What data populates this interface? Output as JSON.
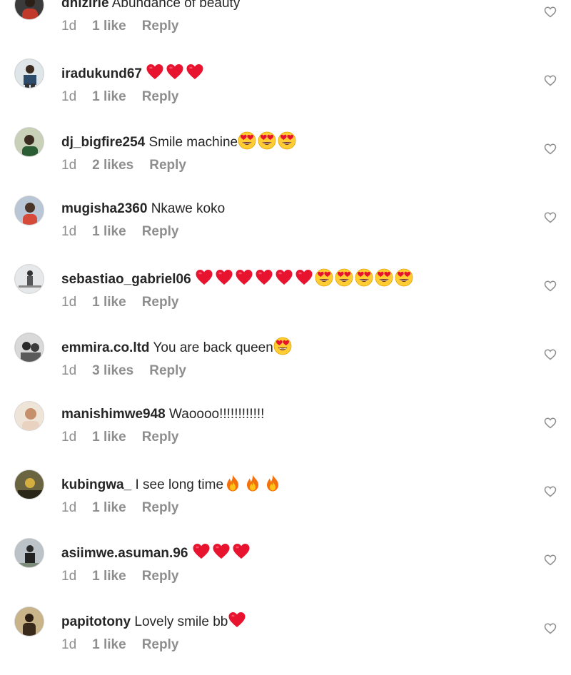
{
  "comments": [
    {
      "username": "dhizirie",
      "text": "Abundance of beauty",
      "emojis": [],
      "time": "1d",
      "likes": "1 like",
      "reply": "Reply",
      "avatar_color": "#3b3b3b"
    },
    {
      "username": "iradukund67",
      "text": "",
      "emojis": [
        "red-heart",
        "red-heart",
        "red-heart"
      ],
      "time": "1d",
      "likes": "1 like",
      "reply": "Reply",
      "avatar_color": "#6a7f8f"
    },
    {
      "username": "dj_bigfire254",
      "text": "Smile machine",
      "emojis": [
        "heart-eyes",
        "heart-eyes",
        "heart-eyes"
      ],
      "time": "1d",
      "likes": "2 likes",
      "reply": "Reply",
      "avatar_color": "#7b8a6a"
    },
    {
      "username": "mugisha2360",
      "text": "Nkawe koko",
      "emojis": [],
      "time": "1d",
      "likes": "1 like",
      "reply": "Reply",
      "avatar_color": "#8e8a86"
    },
    {
      "username": "sebastiao_gabriel06",
      "text": "",
      "emojis": [
        "red-heart",
        "red-heart",
        "red-heart",
        "red-heart",
        "red-heart",
        "red-heart",
        "heart-eyes",
        "heart-eyes",
        "heart-eyes",
        "heart-eyes",
        "heart-eyes"
      ],
      "time": "1d",
      "likes": "1 like",
      "reply": "Reply",
      "avatar_color": "#9aa0a6"
    },
    {
      "username": "emmira.co.ltd",
      "text": "You are back queen",
      "emojis": [
        "heart-eyes"
      ],
      "time": "1d",
      "likes": "3 likes",
      "reply": "Reply",
      "avatar_color": "#555555"
    },
    {
      "username": "manishimwe948",
      "text": "Waoooo!!!!!!!!!!!!",
      "emojis": [],
      "time": "1d",
      "likes": "1 like",
      "reply": "Reply",
      "avatar_color": "#c9b7a5"
    },
    {
      "username": "kubingwa_",
      "text": "I see long time",
      "emojis": [
        "fire",
        "fire",
        "fire"
      ],
      "time": "1d",
      "likes": "1 like",
      "reply": "Reply",
      "avatar_color": "#4a4632"
    },
    {
      "username": "asiimwe.asuman.96",
      "text": "",
      "emojis": [
        "red-heart",
        "red-heart",
        "red-heart"
      ],
      "time": "1d",
      "likes": "1 like",
      "reply": "Reply",
      "avatar_color": "#5d6068"
    },
    {
      "username": "papitotony",
      "text": "Lovely smile bb",
      "emojis": [
        "red-heart"
      ],
      "time": "1d",
      "likes": "1 like",
      "reply": "Reply",
      "avatar_color": "#6b5a3e"
    }
  ],
  "colors": {
    "text": "#262626",
    "meta": "#8e8e8e",
    "heart_red": "#e0245e",
    "emoji_yellow": "#ffcc33"
  }
}
